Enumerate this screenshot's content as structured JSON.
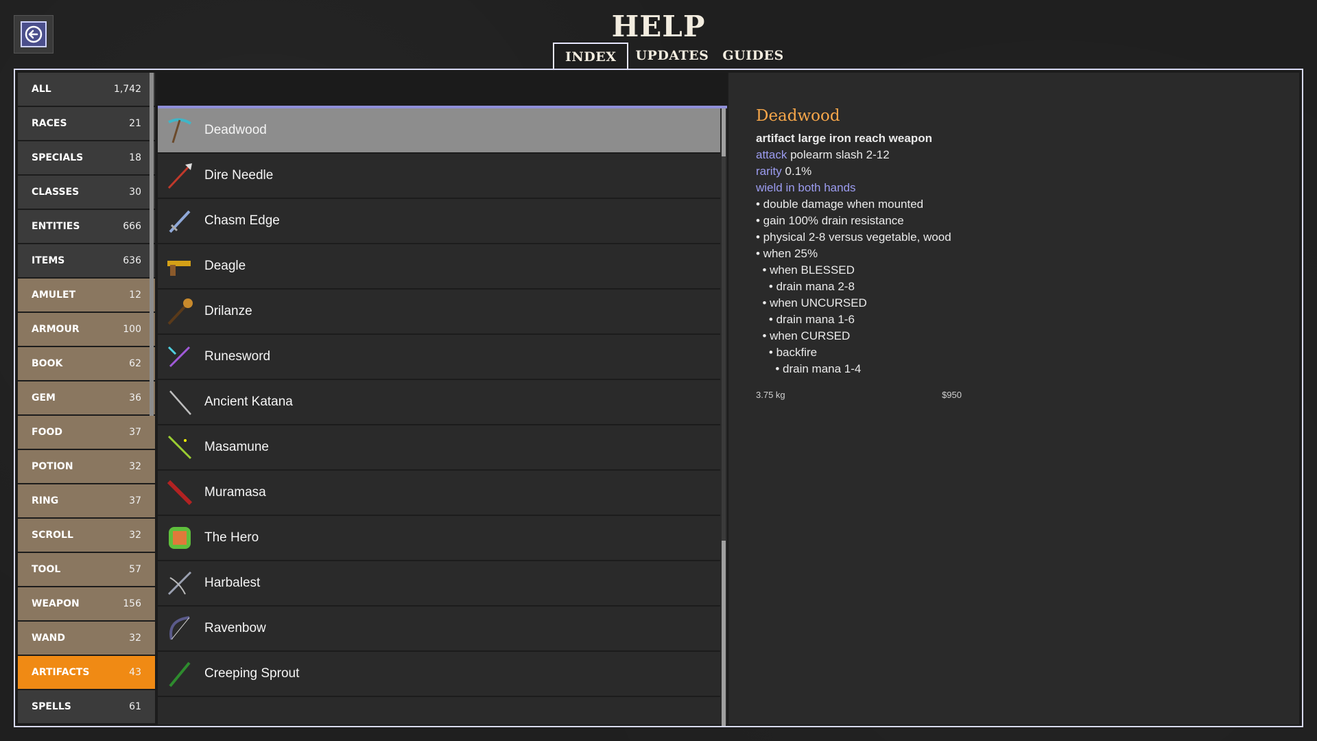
{
  "header": {
    "title": "HELP",
    "tabs": [
      {
        "label": "INDEX",
        "active": true
      },
      {
        "label": "UPDATES",
        "active": false
      },
      {
        "label": "GUIDES",
        "active": false
      }
    ]
  },
  "back_icon": "arrow-left-icon",
  "categories": [
    {
      "label": "ALL",
      "count": "1,742",
      "style": "gray"
    },
    {
      "label": "RACES",
      "count": "21",
      "style": "gray"
    },
    {
      "label": "SPECIALS",
      "count": "18",
      "style": "gray"
    },
    {
      "label": "CLASSES",
      "count": "30",
      "style": "gray"
    },
    {
      "label": "ENTITIES",
      "count": "666",
      "style": "gray"
    },
    {
      "label": "ITEMS",
      "count": "636",
      "style": "gray"
    },
    {
      "label": "AMULET",
      "count": "12",
      "style": "tan"
    },
    {
      "label": "ARMOUR",
      "count": "100",
      "style": "tan"
    },
    {
      "label": "BOOK",
      "count": "62",
      "style": "tan"
    },
    {
      "label": "GEM",
      "count": "36",
      "style": "tan"
    },
    {
      "label": "FOOD",
      "count": "37",
      "style": "tan"
    },
    {
      "label": "POTION",
      "count": "32",
      "style": "tan"
    },
    {
      "label": "RING",
      "count": "37",
      "style": "tan"
    },
    {
      "label": "SCROLL",
      "count": "32",
      "style": "tan"
    },
    {
      "label": "TOOL",
      "count": "57",
      "style": "tan"
    },
    {
      "label": "WEAPON",
      "count": "156",
      "style": "tan"
    },
    {
      "label": "WAND",
      "count": "32",
      "style": "tan"
    },
    {
      "label": "ARTIFACTS",
      "count": "43",
      "style": "orange"
    },
    {
      "label": "SPELLS",
      "count": "61",
      "style": "gray"
    }
  ],
  "items": [
    {
      "name": "Deadwood",
      "icon": "pickaxe-icon",
      "color": "#3fb6c8",
      "selected": true
    },
    {
      "name": "Dire Needle",
      "icon": "spear-icon",
      "color": "#c0392b",
      "selected": false
    },
    {
      "name": "Chasm Edge",
      "icon": "sword-icon",
      "color": "#8fa8d8",
      "selected": false
    },
    {
      "name": "Deagle",
      "icon": "pistol-icon",
      "color": "#d4a017",
      "selected": false
    },
    {
      "name": "Drilanze",
      "icon": "lance-icon",
      "color": "#c88a2c",
      "selected": false
    },
    {
      "name": "Runesword",
      "icon": "rune-sword-icon",
      "color": "#a05ad8",
      "selected": false
    },
    {
      "name": "Ancient Katana",
      "icon": "katana-icon",
      "color": "#bdbdbd",
      "selected": false
    },
    {
      "name": "Masamune",
      "icon": "blade-icon",
      "color": "#9acd32",
      "selected": false
    },
    {
      "name": "Muramasa",
      "icon": "cursed-blade-icon",
      "color": "#b22222",
      "selected": false
    },
    {
      "name": "The Hero",
      "icon": "shield-icon",
      "color": "#5fbf3c",
      "selected": false
    },
    {
      "name": "Harbalest",
      "icon": "crossbow-icon",
      "color": "#9aa0b0",
      "selected": false
    },
    {
      "name": "Ravenbow",
      "icon": "bow-icon",
      "color": "#5a5a8a",
      "selected": false
    },
    {
      "name": "Creeping Sprout",
      "icon": "staff-icon",
      "color": "#2e8b2e",
      "selected": false
    }
  ],
  "detail": {
    "title": "Deadwood",
    "subtitle": "artifact large iron reach weapon",
    "attack_key": "attack",
    "attack_val": "polearm slash 2-12",
    "rarity_key": "rarity",
    "rarity_val": "0.1%",
    "wield": "wield in both hands",
    "effects": [
      "• double damage when mounted",
      "• gain 100% drain resistance",
      "• physical 2-8 versus vegetable, wood",
      "• when 25%",
      "  • when BLESSED",
      "    • drain mana 2-8",
      "  • when UNCURSED",
      "    • drain mana 1-6",
      "  • when CURSED",
      "    • backfire",
      "      • drain mana 1-4"
    ],
    "weight": "3.75 kg",
    "price": "$950"
  },
  "colors": {
    "accent_orange": "#f08a14",
    "selected_row": "#8d8d8d",
    "keyword": "#9c9cf0",
    "title_orange": "#f6a64a"
  }
}
